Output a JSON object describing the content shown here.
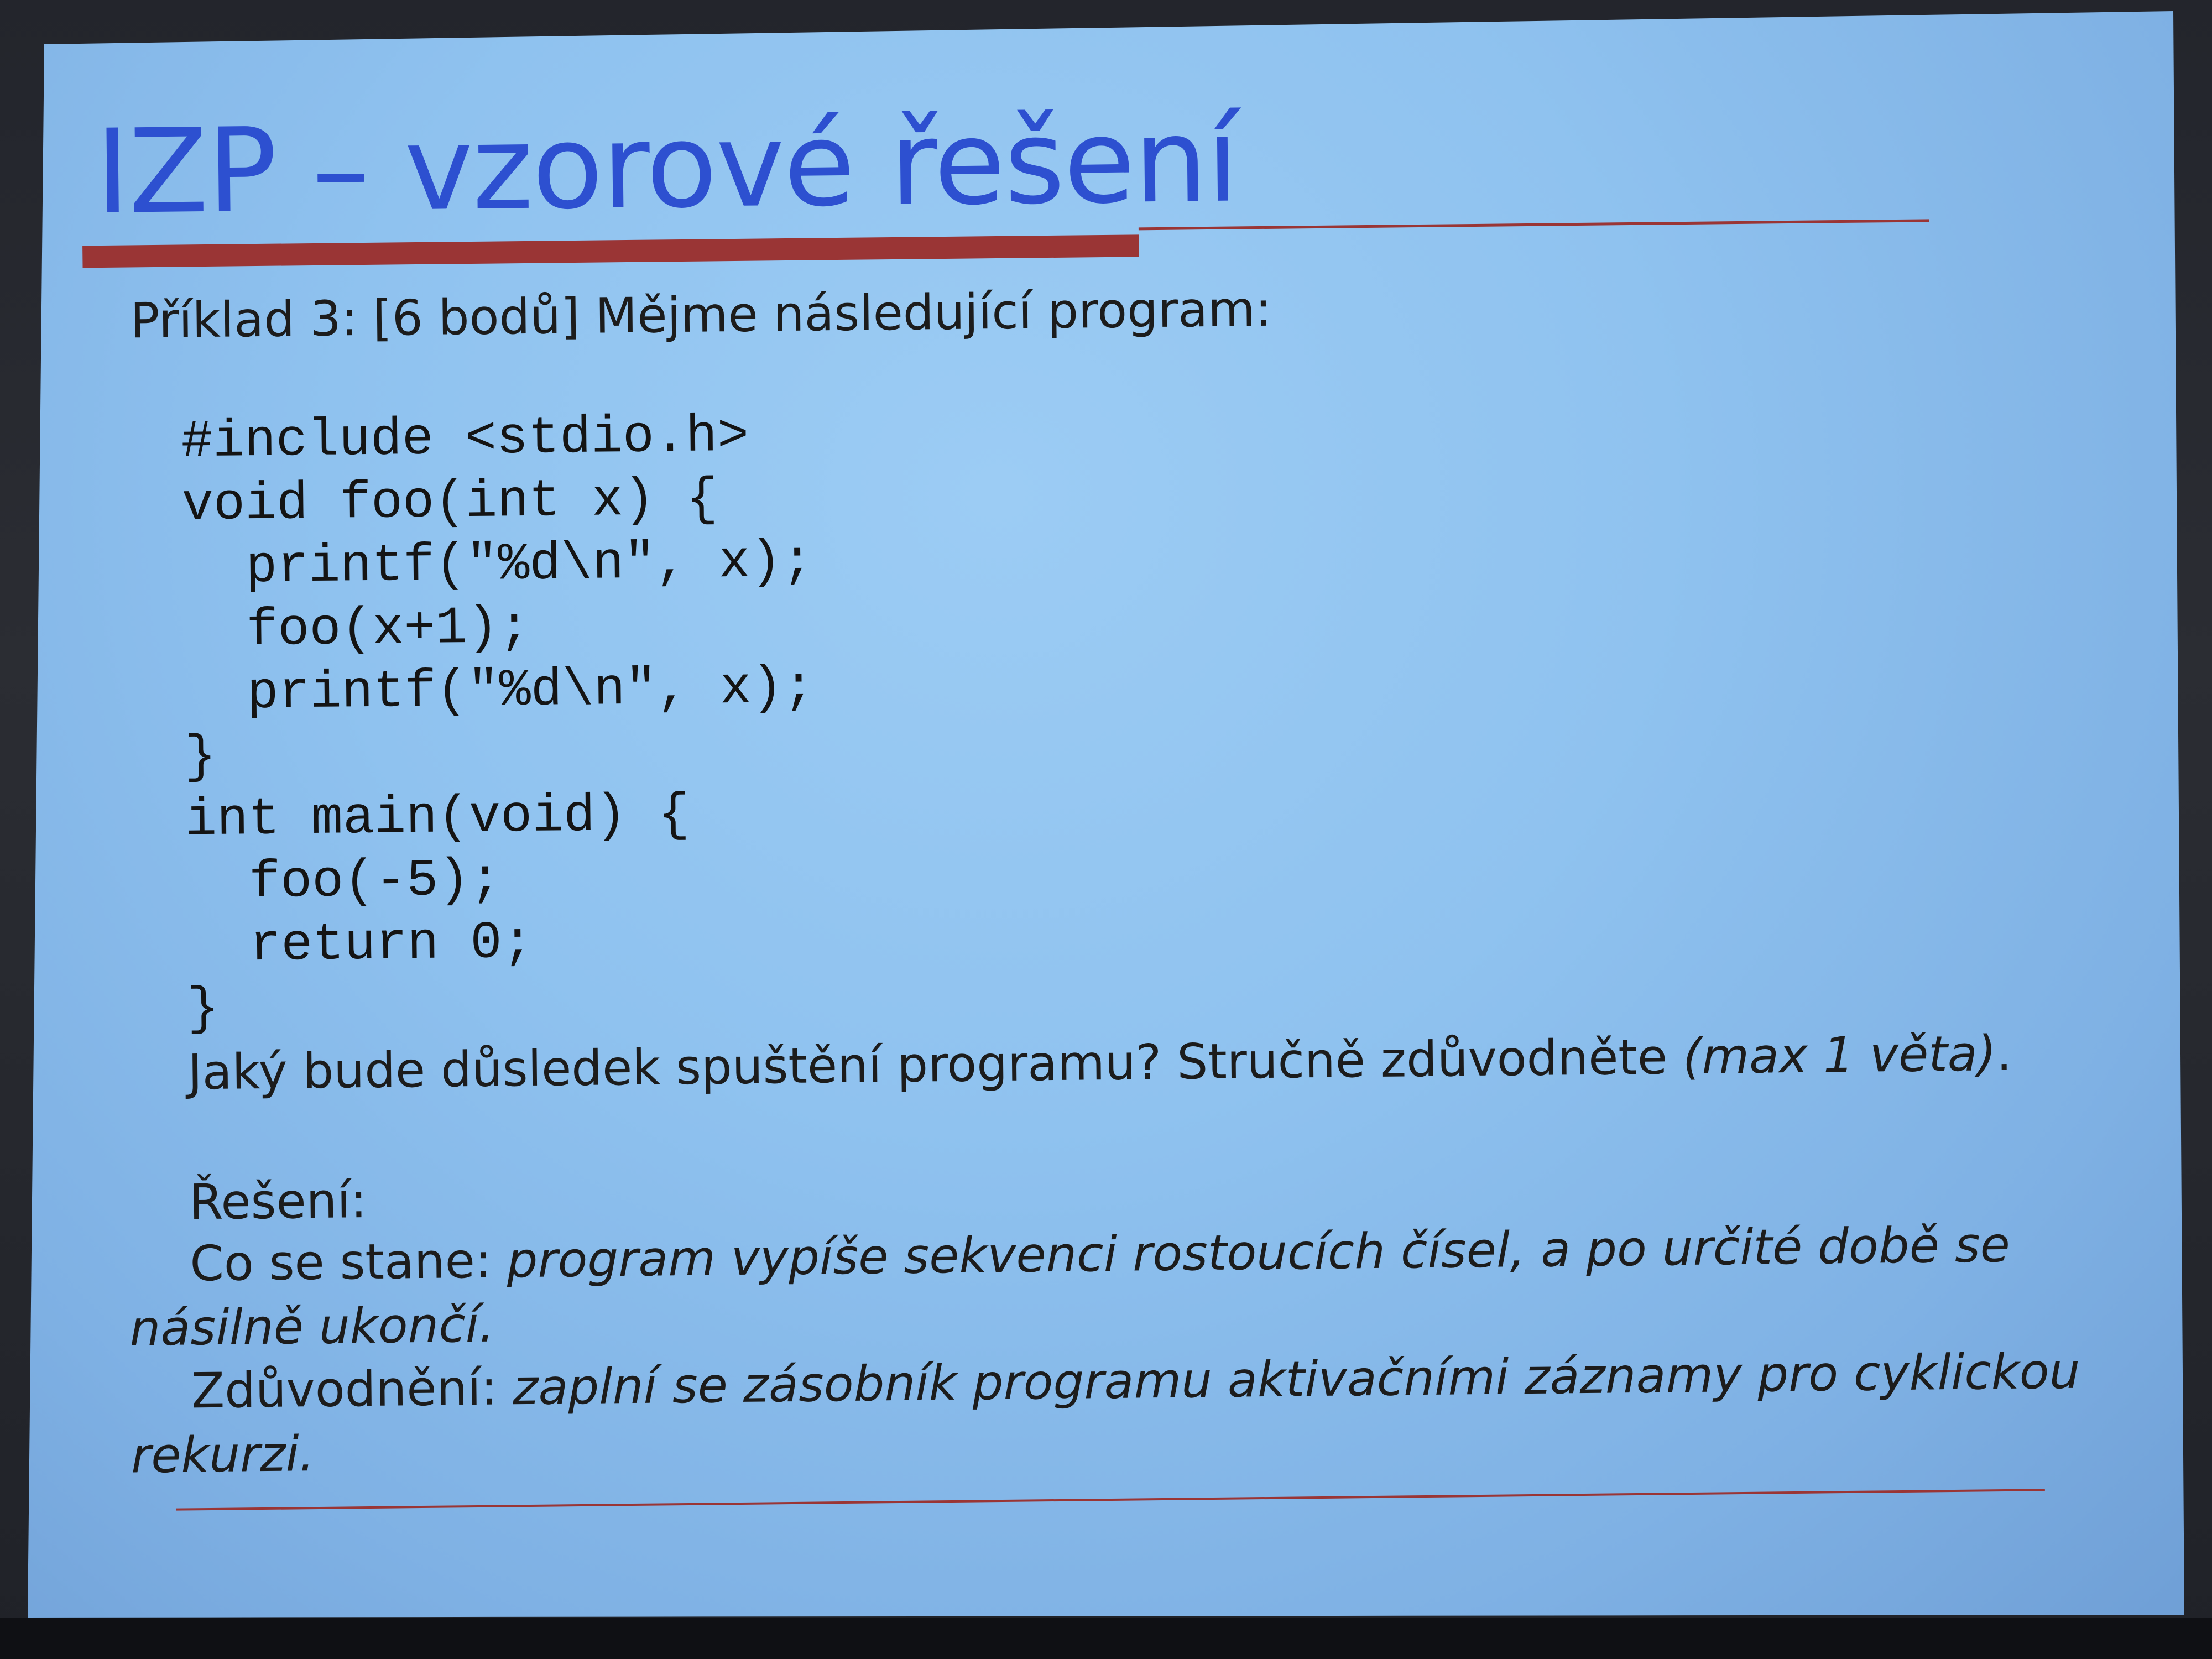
{
  "slide": {
    "title": "IZP – vzorové řešení",
    "intro": "Příklad 3: [6 bodů] Mějme následující program:",
    "code_lines": [
      "#include <stdio.h>",
      "void foo(int x) {",
      "  printf(\"%d\\n\", x);",
      "  foo(x+1);",
      "  printf(\"%d\\n\", x);",
      "}",
      "int main(void) {",
      "  foo(-5);",
      "  return 0;",
      "}"
    ],
    "question": {
      "text": "Jaký bude důsledek spuštění programu? Stručně zdůvodněte ",
      "emphasis": "(max 1 věta)",
      "end": "."
    },
    "solution_heading": "Řešení:",
    "what_happens": {
      "label": "Co se stane: ",
      "text": "program vypíše sekvenci rostoucích čísel, a po určité době se násilně ukončí."
    },
    "justification": {
      "label": "Zdůvodnění: ",
      "text": "zaplní se zásobník programu aktivačními záznamy pro cyklickou rekurzi."
    }
  },
  "colors": {
    "title": "#2d50d0",
    "accent_red": "#9a3535",
    "slide_background": "#8fc2ef",
    "text": "#1c1c1c"
  }
}
